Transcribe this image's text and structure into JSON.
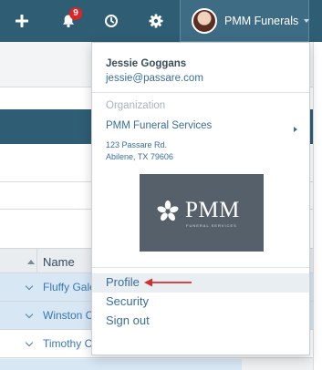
{
  "topnav": {
    "add_icon": "plus-icon",
    "notifications_icon": "bell-icon",
    "notification_count": "9",
    "history_icon": "clock-icon",
    "settings_icon": "gear-icon",
    "account_name": "PMM Funerals",
    "bg_color": "#2f5d74",
    "badge_color": "#e02424"
  },
  "account_menu": {
    "user_name": "Jessie Goggans",
    "user_email": "jessie@passare.com",
    "org_label": "Organization",
    "org_name": "PMM Funeral Services",
    "address_line1": "123 Passare Rd.",
    "address_line2": "Abilene, TX 79606",
    "logo_text": "PMM",
    "logo_subtext": "FUNERAL SERVICES",
    "items": [
      {
        "label": "Profile",
        "active": true
      },
      {
        "label": "Security",
        "active": false
      },
      {
        "label": "Sign out",
        "active": false
      }
    ],
    "annotation_color": "#d32f2f"
  },
  "table": {
    "column_name": "Name",
    "rows": [
      "Fluffy Gales",
      "Winston Ch",
      "Timothy Ch"
    ]
  }
}
